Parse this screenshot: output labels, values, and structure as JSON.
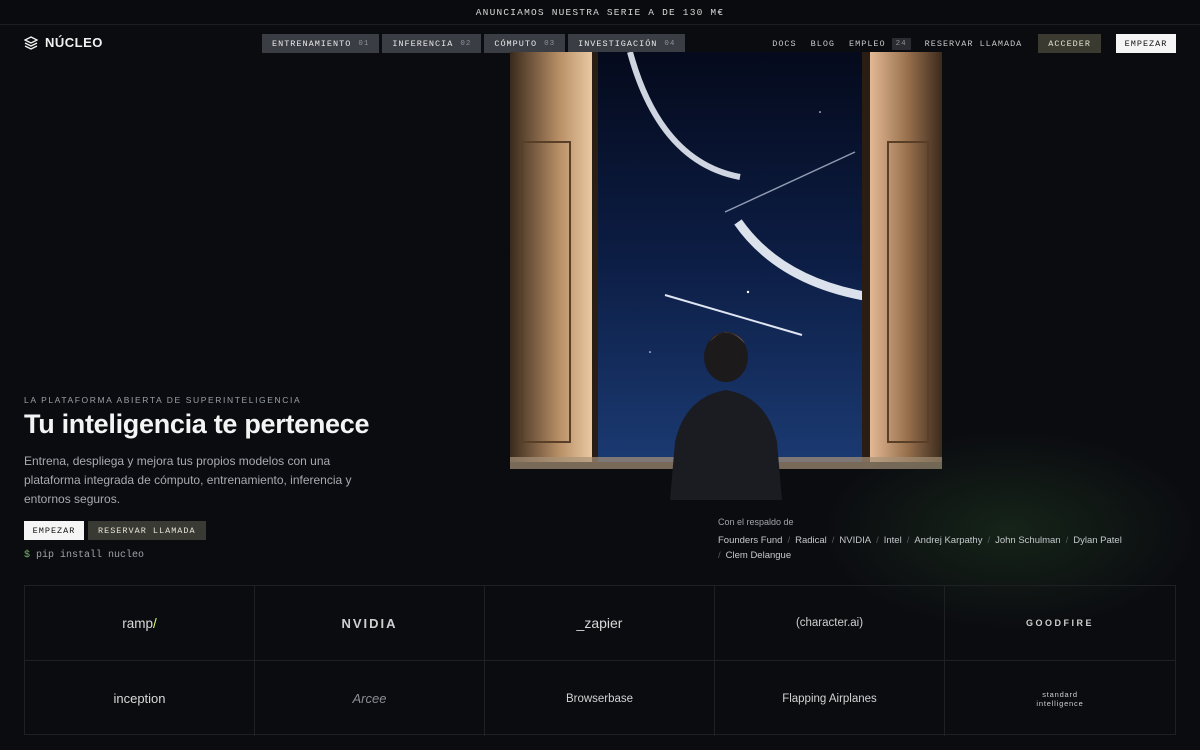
{
  "announcement": "ANUNCIAMOS NUESTRA SERIE A DE 130 M€",
  "brand": {
    "name": "NÚCLEO",
    "icon": "layers-icon"
  },
  "nav_tabs": [
    {
      "label": "ENTRENAMIENTO",
      "num": "01"
    },
    {
      "label": "INFERENCIA",
      "num": "02"
    },
    {
      "label": "CÓMPUTO",
      "num": "03"
    },
    {
      "label": "INVESTIGACIÓN",
      "num": "04"
    }
  ],
  "nav_right": {
    "docs": "DOCS",
    "blog": "BLOG",
    "jobs": "EMPLEO",
    "jobs_count": "24",
    "book_call": "RESERVAR LLAMADA",
    "login": "ACCEDER",
    "start": "EMPEZAR"
  },
  "hero": {
    "eyebrow": "LA PLATAFORMA ABIERTA DE SUPERINTELIGENCIA",
    "headline": "Tu inteligencia te pertenece",
    "subtitle": "Entrena, despliega y mejora tus propios modelos con una plataforma integrada de cómputo, entrenamiento, inferencia y entornos seguros.",
    "cta_primary": "EMPEZAR",
    "cta_secondary": "RESERVAR LLAMADA",
    "cli_prompt": "$",
    "cli_command": "pip install nucleo"
  },
  "backers": {
    "label": "Con el respaldo de",
    "names": [
      "Founders Fund",
      "Radical",
      "NVIDIA",
      "Intel",
      "Andrej Karpathy",
      "John Schulman",
      "Dylan Patel",
      "Clem Delangue"
    ]
  },
  "logos": {
    "ramp": "ramp",
    "ramp_slash": "/",
    "nvidia": "NVIDIA",
    "zapier": "_zapier",
    "character": "(character.ai)",
    "goodfire": "GOODFIRE",
    "inception": "inception",
    "arcee": "Arcee",
    "browserbase": "Browserbase",
    "flapping": "Flapping Airplanes",
    "standard_line1": "standard",
    "standard_line2": "intelligence"
  },
  "colors": {
    "background": "#0b0c10",
    "tab_bg": "#3a3d44",
    "accent_green": "#78b36b",
    "ramp_accent": "#d6ff6b"
  }
}
